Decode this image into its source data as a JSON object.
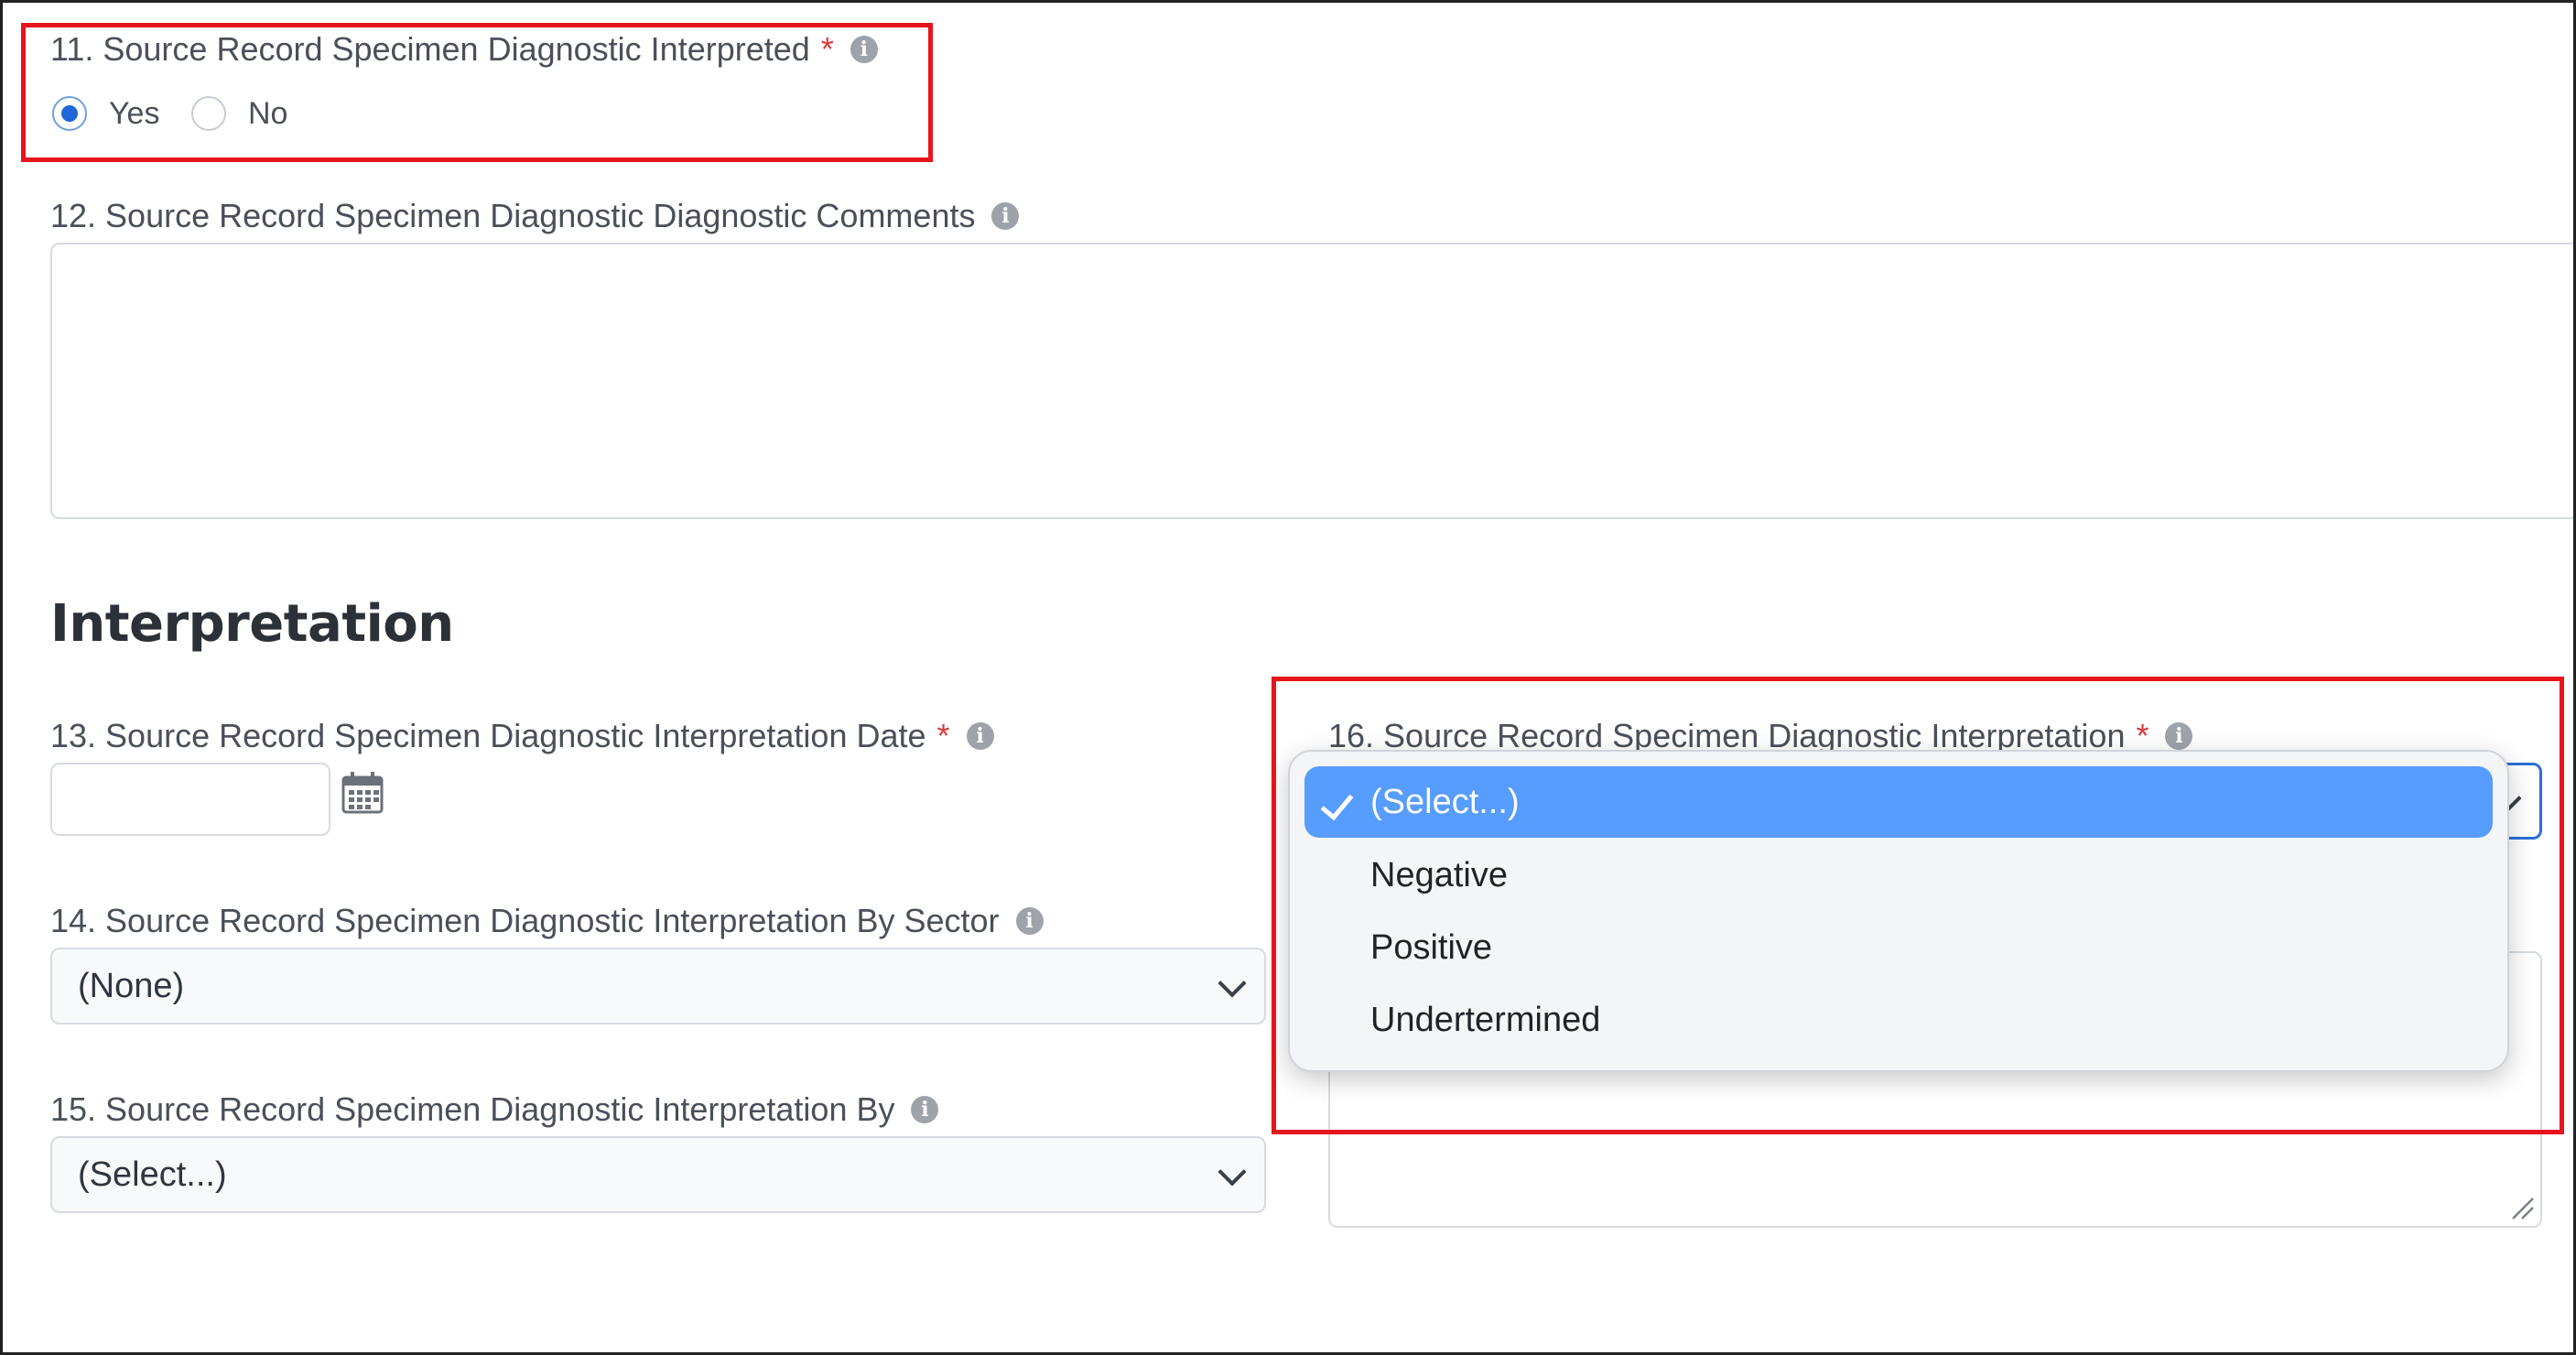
{
  "required_mark": "*",
  "info_glyph": "i",
  "q11": {
    "label": "11. Source Record Specimen Diagnostic Interpreted",
    "required": true,
    "options": [
      {
        "label": "Yes",
        "selected": true
      },
      {
        "label": "No",
        "selected": false
      }
    ]
  },
  "q12": {
    "label": "12. Source Record Specimen Diagnostic Diagnostic Comments",
    "value": ""
  },
  "section_heading": "Interpretation",
  "q13": {
    "label": "13. Source Record Specimen Diagnostic Interpretation Date",
    "required": true,
    "value": "",
    "icon": "calendar-icon"
  },
  "q14": {
    "label": "14. Source Record Specimen Diagnostic Interpretation By Sector",
    "value": "(None)"
  },
  "q15": {
    "label": "15. Source Record Specimen Diagnostic Interpretation By",
    "value": "(Select...)"
  },
  "q16": {
    "label": "16. Source Record Specimen Diagnostic Interpretation",
    "required": true,
    "dropdown_open": true,
    "options": [
      {
        "label": "(Select...)",
        "selected": true
      },
      {
        "label": "Negative",
        "selected": false
      },
      {
        "label": "Positive",
        "selected": false
      },
      {
        "label": "Undertermined",
        "selected": false
      }
    ]
  },
  "colors": {
    "highlight_box": "#e8141c",
    "required_asterisk": "#e0393e",
    "radio_selected": "#1f66d6",
    "dropdown_selected_bg": "#579cff"
  }
}
